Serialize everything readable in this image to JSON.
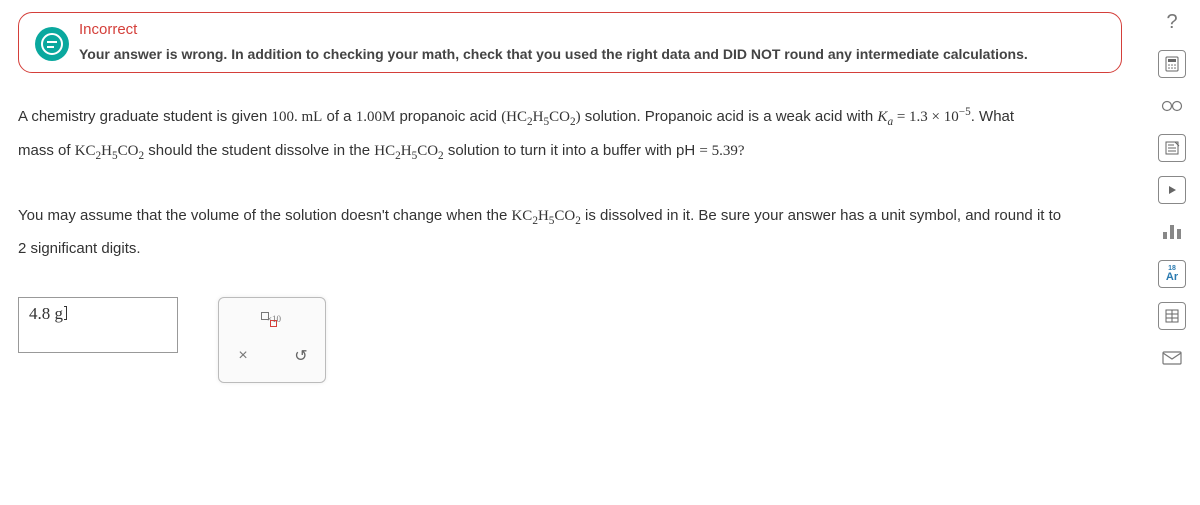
{
  "feedback": {
    "title": "Incorrect",
    "message": "Your answer is wrong. In addition to checking your math, check that you used the right data and DID NOT round any intermediate calculations."
  },
  "question": {
    "line1_a": "A chemistry graduate student is given ",
    "volume": "100. mL",
    "line1_b": " of a ",
    "conc": "1.00M",
    "line1_c": " propanoic acid ",
    "acid_formula_open": "(HC",
    "acid_formula_close": ")",
    "line1_d": " solution. Propanoic acid is a weak acid with ",
    "ka_symbol": "K",
    "ka_sub": "a",
    "ka_equals": " = 1.3 × 10",
    "ka_exp": "−5",
    "line1_e": ". What",
    "line2_a": "mass of ",
    "salt_formula": "KC",
    "line2_b": " should the student dissolve in the ",
    "line2_c": " solution to turn it into a buffer with pH ",
    "ph_equals": "= 5.39?",
    "line3_a": "You may assume that the volume of the solution doesn't change when the ",
    "line3_b": " is dissolved in it. Be sure your answer has a unit symbol, and round it to",
    "line3_c": "2 significant digits."
  },
  "answer": {
    "value": "4.8 g"
  },
  "tools": {
    "scientific_notation": "×10",
    "clear": "×",
    "undo": "↺"
  },
  "rail": {
    "help": "?",
    "glasses": "👓",
    "ar_top": "18",
    "ar_label": "Ar"
  }
}
